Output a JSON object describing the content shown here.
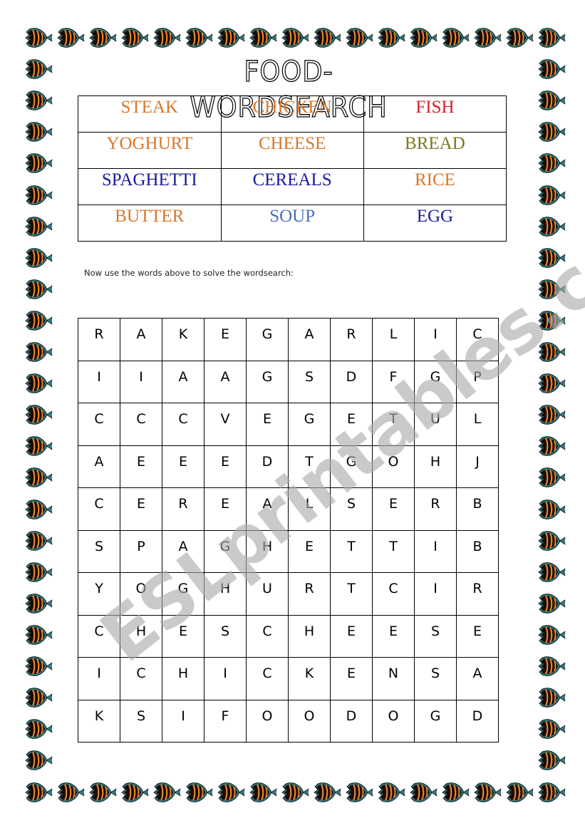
{
  "title": "FOOD- WORDSEARCH",
  "border": {
    "icon": "angelfish-icon",
    "colors": {
      "body": "#1a0b0b",
      "stripe": "#e8842c",
      "fin": "#2b7a82"
    }
  },
  "word_list": {
    "rows": [
      [
        {
          "word": "STEAK",
          "color": "#d9772a"
        },
        {
          "word": "CHICKEN",
          "color": "#d9772a"
        },
        {
          "word": "FISH",
          "color": "#d4202a"
        }
      ],
      [
        {
          "word": "YOGHURT",
          "color": "#d9772a"
        },
        {
          "word": "CHEESE",
          "color": "#d9772a"
        },
        {
          "word": "BREAD",
          "color": "#7a7a1e"
        }
      ],
      [
        {
          "word": "SPAGHETTI",
          "color": "#1a1a9a"
        },
        {
          "word": "CEREALS",
          "color": "#1a1a9a"
        },
        {
          "word": "RICE",
          "color": "#d9772a"
        }
      ],
      [
        {
          "word": "BUTTER",
          "color": "#d9772a"
        },
        {
          "word": "SOUP",
          "color": "#4a6fc0"
        },
        {
          "word": "EGG",
          "color": "#1a1a9a"
        }
      ]
    ]
  },
  "instruction": "Now use the words above to solve the wordsearch:",
  "grid": [
    [
      "R",
      "A",
      "K",
      "E",
      "G",
      "A",
      "R",
      "L",
      "I",
      "C"
    ],
    [
      "I",
      "I",
      "A",
      "A",
      "G",
      "S",
      "D",
      "F",
      "G",
      "P"
    ],
    [
      "C",
      "C",
      "C",
      "V",
      "E",
      "G",
      "E",
      "T",
      "U",
      "L"
    ],
    [
      "A",
      "E",
      "E",
      "E",
      "D",
      "T",
      "G",
      "O",
      "H",
      "J"
    ],
    [
      "C",
      "E",
      "R",
      "E",
      "A",
      "L",
      "S",
      "E",
      "R",
      "B"
    ],
    [
      "S",
      "P",
      "A",
      "G",
      "H",
      "E",
      "T",
      "T",
      "I",
      "B"
    ],
    [
      "Y",
      "O",
      "G",
      "H",
      "U",
      "R",
      "T",
      "C",
      "I",
      "R"
    ],
    [
      "C",
      "H",
      "E",
      "S",
      "C",
      "H",
      "E",
      "E",
      "S",
      "E"
    ],
    [
      "I",
      "C",
      "H",
      "I",
      "C",
      "K",
      "E",
      "N",
      "S",
      "A"
    ],
    [
      "K",
      "S",
      "I",
      "F",
      "O",
      "O",
      "D",
      "O",
      "G",
      "D"
    ]
  ],
  "watermark": "ESLprintables.com"
}
